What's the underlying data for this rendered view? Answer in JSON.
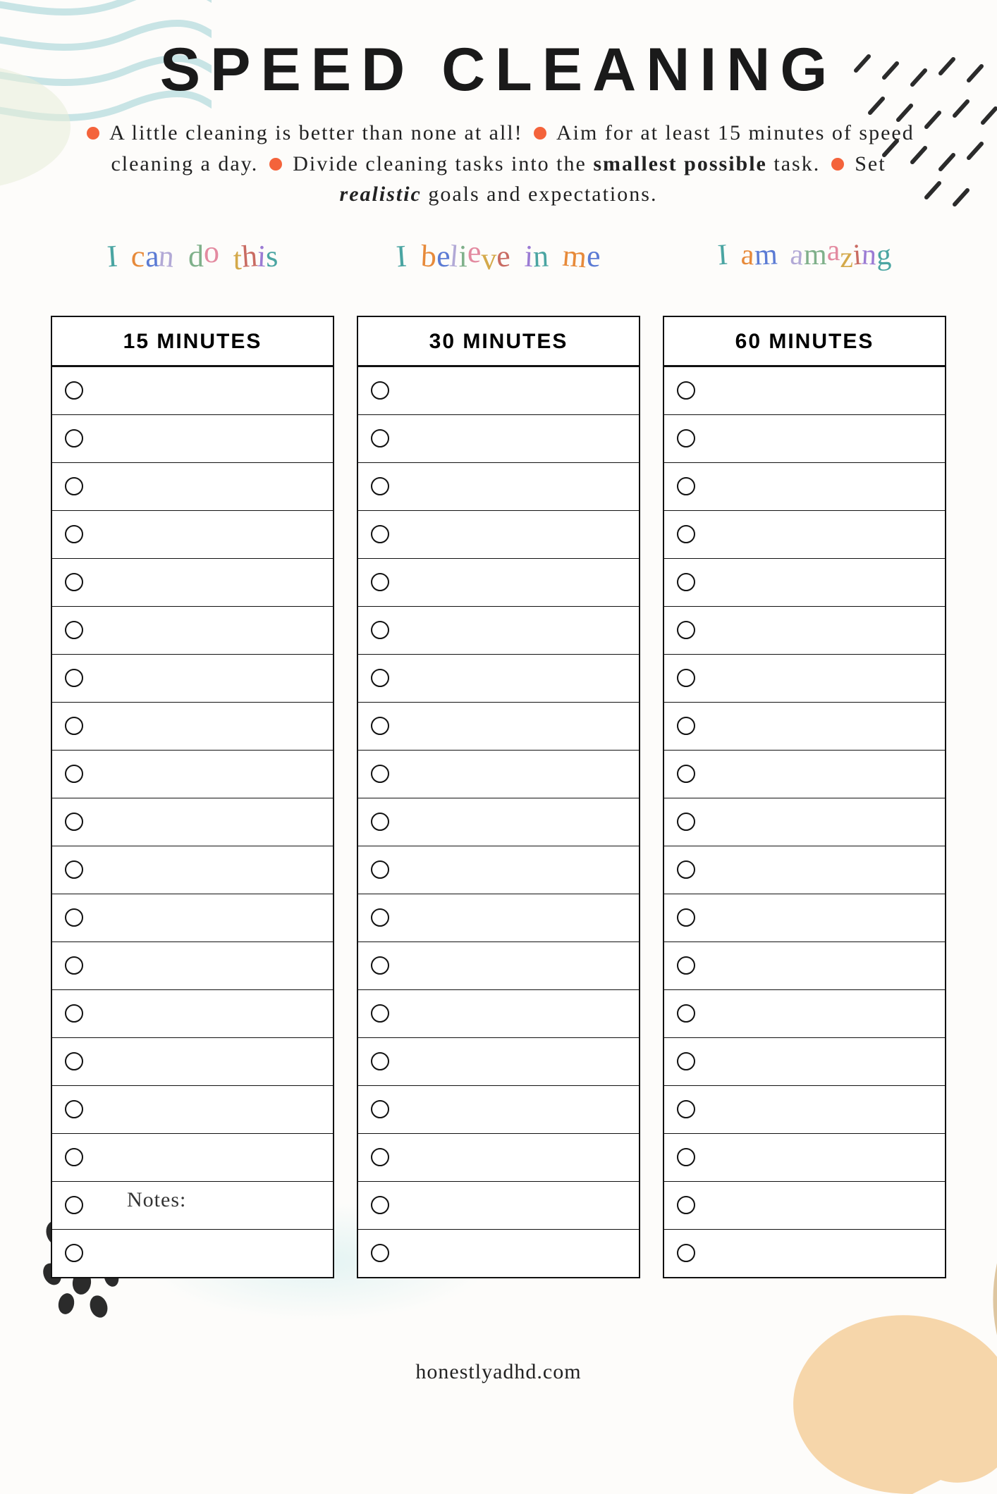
{
  "title": "SPEED CLEANING",
  "intro": {
    "tip1": "A little cleaning is better than none at all!",
    "tip2_a": "Aim for at least 15 minutes of speed cleaning a day.",
    "tip3_a": "Divide cleaning tasks into the ",
    "tip3_bold": "smallest possible",
    "tip3_b": " task.",
    "tip4_a": "Set ",
    "tip4_italic": "realistic",
    "tip4_b": " goals and expectations."
  },
  "affirmations": {
    "col1": "I can do this",
    "col2": "I believe in me",
    "col3": "I am amazing"
  },
  "columns": [
    {
      "header": "15 MINUTES",
      "rows": [
        "",
        "",
        "",
        "",
        "",
        "",
        "",
        "",
        "",
        "",
        "",
        "",
        "",
        "",
        "",
        "",
        "",
        "",
        ""
      ]
    },
    {
      "header": "30 MINUTES",
      "rows": [
        "",
        "",
        "",
        "",
        "",
        "",
        "",
        "",
        "",
        "",
        "",
        "",
        "",
        "",
        "",
        "",
        "",
        "",
        ""
      ]
    },
    {
      "header": "60 MINUTES",
      "rows": [
        "",
        "",
        "",
        "",
        "",
        "",
        "",
        "",
        "",
        "",
        "",
        "",
        "",
        "",
        "",
        "",
        "",
        "",
        ""
      ]
    }
  ],
  "notes_label": "Notes:",
  "footer": "honestlyadhd.com"
}
